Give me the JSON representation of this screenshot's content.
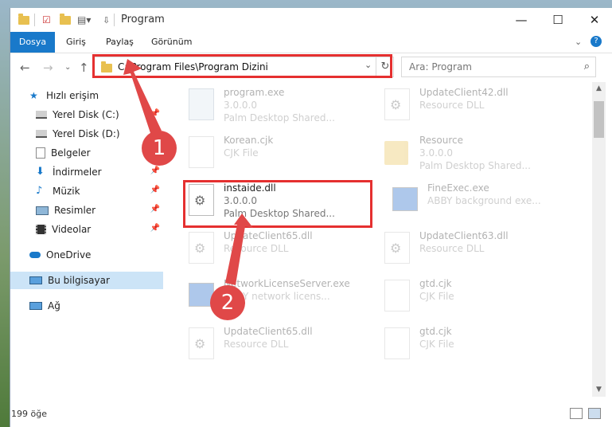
{
  "window": {
    "title": "Program",
    "minimize": "—",
    "maximize": "☐",
    "close": "✕"
  },
  "ribbon": {
    "tabs": [
      "Dosya",
      "Giriş",
      "Paylaş",
      "Görünüm"
    ],
    "help": "?",
    "expand": "⌄"
  },
  "address": {
    "path": "C:\\Program Files\\Program Dizini",
    "dropdown": "⌄",
    "refresh": "↻"
  },
  "search": {
    "placeholder": "Ara: Program",
    "icon": "search-icon"
  },
  "nav": {
    "back": "←",
    "forward": "→",
    "recent": "⌄",
    "up": "↑",
    "quick_access": "Hızlı erişim",
    "items": [
      {
        "label": "Yerel Disk (C:)",
        "icon": "drive-icon",
        "pinned": true
      },
      {
        "label": "Yerel Disk (D:)",
        "icon": "drive-icon",
        "pinned": true
      },
      {
        "label": "Belgeler",
        "icon": "documents-icon",
        "pinned": true
      },
      {
        "label": "İndirmeler",
        "icon": "download-icon",
        "pinned": true
      },
      {
        "label": "Müzik",
        "icon": "music-icon",
        "pinned": true
      },
      {
        "label": "Resimler",
        "icon": "pictures-icon",
        "pinned": true
      },
      {
        "label": "Videolar",
        "icon": "videos-icon",
        "pinned": true
      }
    ],
    "onedrive": "OneDrive",
    "this_pc": "Bu bilgisayar",
    "network": "Ağ"
  },
  "files": [
    {
      "name": "program.exe",
      "line2": "3.0.0.0",
      "line3": "Palm Desktop Shared...",
      "icon": "exe-icon",
      "faded": true
    },
    {
      "name": "UpdateClient42.dll",
      "line2": "Resource DLL",
      "line3": "",
      "icon": "dll-icon",
      "faded": true
    },
    {
      "name": "Korean.cjk",
      "line2": "CJK File",
      "line3": "",
      "icon": "file-icon",
      "faded": true
    },
    {
      "name": "Resource",
      "line2": "3.0.0.0",
      "line3": "Palm Desktop Shared...",
      "icon": "folder-icon",
      "faded": true
    },
    {
      "name": "instaide.dll",
      "line2": "3.0.0.0",
      "line3": "Palm Desktop Shared...",
      "icon": "dll-icon",
      "faded": false
    },
    {
      "name": "FineExec.exe",
      "line2": "ABBY background exe...",
      "line3": "",
      "icon": "exe-icon",
      "faded": true
    },
    {
      "name": "UpdateClient65.dll",
      "line2": "Resource DLL",
      "line3": "",
      "icon": "dll-icon",
      "faded": true
    },
    {
      "name": "UpdateClient63.dll",
      "line2": "Resource DLL",
      "line3": "",
      "icon": "dll-icon",
      "faded": true
    },
    {
      "name": "NetworkLicenseServer.exe",
      "line2": "ABBY network licens...",
      "line3": "",
      "icon": "exe-icon",
      "faded": true
    },
    {
      "name": "gtd.cjk",
      "line2": "CJK File",
      "line3": "",
      "icon": "file-icon",
      "faded": true
    },
    {
      "name": "UpdateClient65.dll",
      "line2": "Resource DLL",
      "line3": "",
      "icon": "dll-icon",
      "faded": true
    },
    {
      "name": "gtd.cjk",
      "line2": "CJK File",
      "line3": "",
      "icon": "file-icon",
      "faded": true
    }
  ],
  "status": {
    "count": "199 öğe"
  },
  "annotations": {
    "badge1": "1",
    "badge2": "2",
    "color": "#e53030"
  }
}
